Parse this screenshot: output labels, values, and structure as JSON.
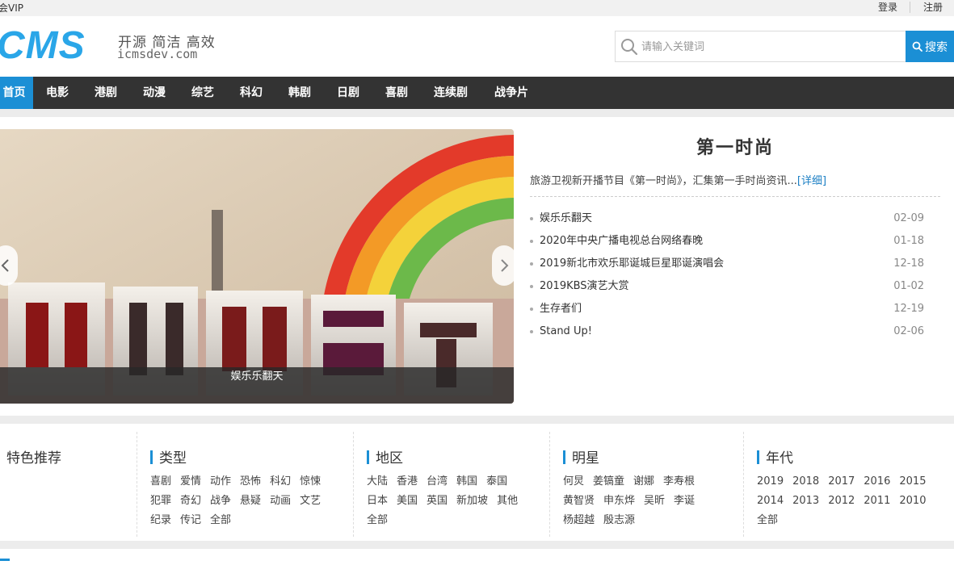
{
  "topbar": {
    "vip": "会VIP",
    "login": "登录",
    "register": "注册"
  },
  "logo": {
    "brand": "CMS",
    "slogan": "开源 简洁 高效",
    "domain": "icmsdev.com"
  },
  "search": {
    "placeholder": "请输入关键词",
    "button": "搜索"
  },
  "nav": {
    "items": [
      "首页",
      "电影",
      "港剧",
      "动漫",
      "综艺",
      "科幻",
      "韩剧",
      "日剧",
      "喜剧",
      "连续剧",
      "战争片"
    ],
    "active": "首页"
  },
  "slider": {
    "caption": "娱乐乐翻天"
  },
  "feature": {
    "title": "第一时尚",
    "desc": "旅游卫视新开播节目《第一时尚》，汇集第一手时尚资讯...",
    "more": "[详细]",
    "news": [
      {
        "title": "娱乐乐翻天",
        "date": "02-09"
      },
      {
        "title": "2020年中央广播电视总台网络春晚",
        "date": "01-18"
      },
      {
        "title": "2019新北市欢乐耶诞城巨星耶诞演唱会",
        "date": "12-18"
      },
      {
        "title": "2019KBS演艺大赏",
        "date": "01-02"
      },
      {
        "title": "生存者们",
        "date": "12-19"
      },
      {
        "title": "Stand Up!",
        "date": "02-06"
      }
    ]
  },
  "categories": {
    "featured": "特色推荐",
    "type": {
      "title": "类型",
      "tags": [
        "喜剧",
        "爱情",
        "动作",
        "恐怖",
        "科幻",
        "惊悚",
        "犯罪",
        "奇幻",
        "战争",
        "悬疑",
        "动画",
        "文艺",
        "纪录",
        "传记",
        "全部"
      ]
    },
    "region": {
      "title": "地区",
      "tags": [
        "大陆",
        "香港",
        "台湾",
        "韩国",
        "泰国",
        "日本",
        "美国",
        "英国",
        "新加坡",
        "其他",
        "全部"
      ]
    },
    "star": {
      "title": "明星",
      "tags": [
        "何炅",
        "姜镐童",
        "谢娜",
        "李寿根",
        "黄智贤",
        "申东烨",
        "吴昕",
        "李诞",
        "杨超越",
        "殷志源"
      ]
    },
    "year": {
      "title": "年代",
      "tags": [
        "2019",
        "2018",
        "2017",
        "2016",
        "2015",
        "2014",
        "2013",
        "2012",
        "2011",
        "2010",
        "全部"
      ]
    }
  },
  "colors": {
    "accent": "#1b8fd5",
    "nav_bg": "#333333",
    "logo": "#2aa6e8"
  }
}
